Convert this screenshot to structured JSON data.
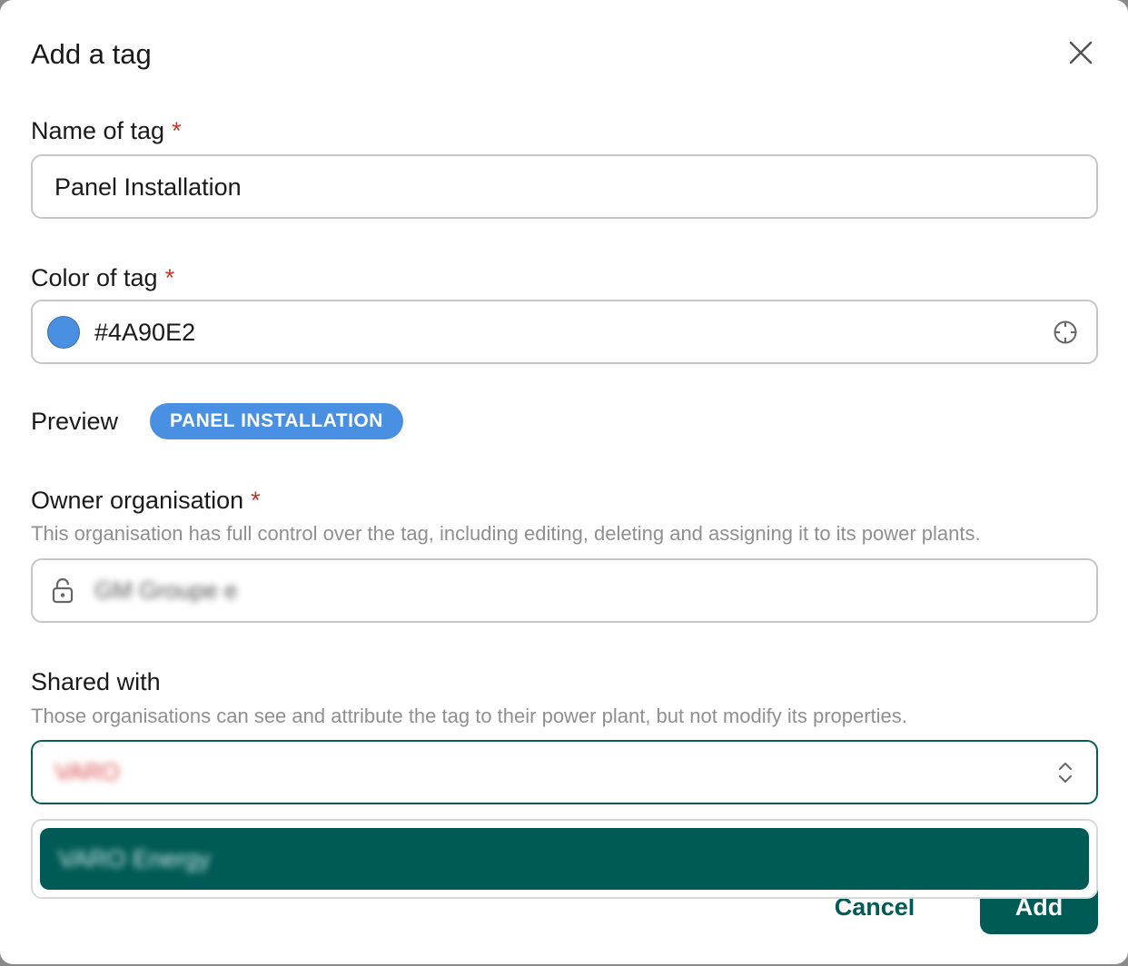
{
  "dialog": {
    "title": "Add a tag",
    "close_icon": "close-icon"
  },
  "name_field": {
    "label": "Name of tag",
    "required_mark": "*",
    "value": "Panel Installation"
  },
  "color_field": {
    "label": "Color of tag",
    "required_mark": "*",
    "value": "#4A90E2",
    "swatch_color": "#4A90E2",
    "picker_icon": "crosshair-icon"
  },
  "preview": {
    "label": "Preview",
    "tag_text": "PANEL INSTALLATION",
    "tag_color": "#4A90E2"
  },
  "owner_field": {
    "label": "Owner organisation",
    "required_mark": "*",
    "help": "This organisation has full control over the tag, including editing, deleting and assigning it to its power plants.",
    "value": "GM Groupe e",
    "lock_icon": "lock-icon"
  },
  "shared_field": {
    "label": "Shared with",
    "help": "Those organisations can see and attribute the tag to their power plant, but not modify its properties.",
    "value": "VARO",
    "dropdown_icon": "chevron-up-down-icon",
    "options": [
      "VARO Energy"
    ]
  },
  "actions": {
    "cancel": "Cancel",
    "add": "Add"
  },
  "colors": {
    "primary": "#005A56",
    "required": "#C0392B"
  }
}
